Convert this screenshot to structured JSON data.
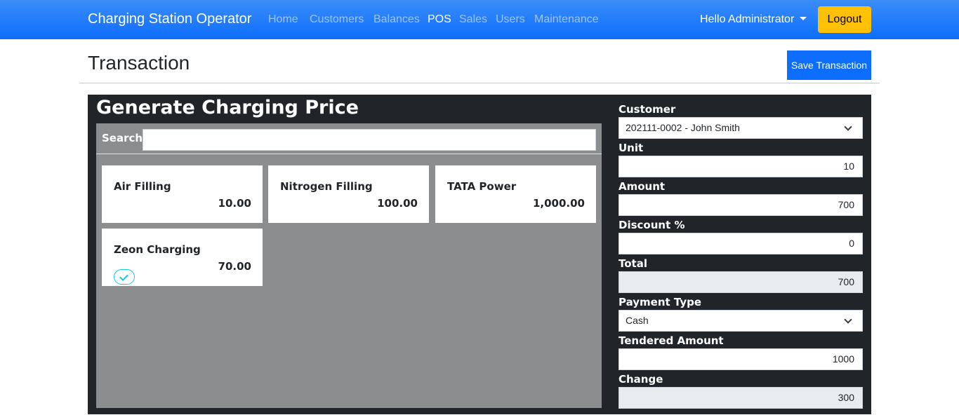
{
  "navbar": {
    "brand": "Charging Station Operator",
    "links": [
      {
        "label": "Home",
        "active": false
      },
      {
        "label": "Customers",
        "active": false
      },
      {
        "label": "Balances",
        "active": false
      },
      {
        "label": "POS",
        "active": true
      },
      {
        "label": "Sales",
        "active": false
      },
      {
        "label": "Users",
        "active": false
      },
      {
        "label": "Maintenance",
        "active": false
      }
    ],
    "greeting": "Hello Administrator",
    "logout_label": "Logout"
  },
  "page": {
    "title": "Transaction",
    "save_label": "Save Transaction"
  },
  "products_panel": {
    "title": "Generate Charging Price",
    "search_label": "Search",
    "search_value": "",
    "products": [
      {
        "name": "Air Filling",
        "price": "10.00",
        "selected": false
      },
      {
        "name": "Nitrogen Filling",
        "price": "100.00",
        "selected": false
      },
      {
        "name": "TATA Power",
        "price": "1,000.00",
        "selected": false
      },
      {
        "name": "Zeon Charging",
        "price": "70.00",
        "selected": true
      }
    ]
  },
  "form": {
    "customer_label": "Customer",
    "customer_value": "202111-0002 - John Smith",
    "unit_label": "Unit",
    "unit_value": "10",
    "amount_label": "Amount",
    "amount_value": "700",
    "discount_label": "Discount %",
    "discount_value": "0",
    "total_label": "Total",
    "total_value": "700",
    "payment_type_label": "Payment Type",
    "payment_type_value": "Cash",
    "tendered_label": "Tendered Amount",
    "tendered_value": "1000",
    "change_label": "Change",
    "change_value": "300"
  },
  "colors": {
    "navbar": "#0d6efd",
    "logout": "#ffc107",
    "panel": "#212529",
    "products_bg": "#8c8d8f",
    "check": "#0dcaf0"
  }
}
